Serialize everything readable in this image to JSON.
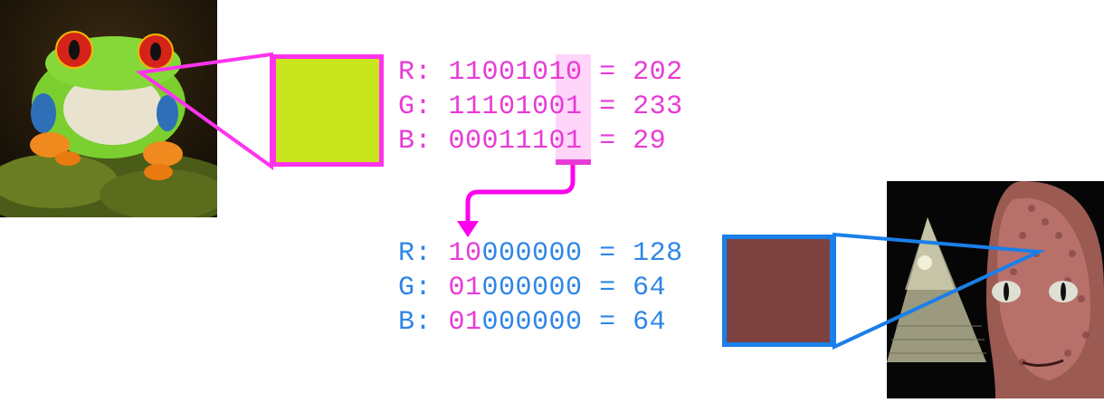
{
  "source": {
    "image": "red-eyed-tree-frog",
    "color_hex": "#c8e61d",
    "rows": [
      {
        "channel": "R: ",
        "bits_high": "110010",
        "bits_low": "10",
        "suffix": " = 202"
      },
      {
        "channel": "G: ",
        "bits_high": "111010",
        "bits_low": "01",
        "suffix": " = 233"
      },
      {
        "channel": "B: ",
        "bits_high": "000111",
        "bits_low": "01",
        "suffix": " = 29"
      }
    ]
  },
  "result": {
    "image": "reptilian-figure-with-pyramid",
    "color_hex": "#7d4240",
    "rows": [
      {
        "channel": "R: ",
        "bits_high": "10",
        "bits_low": "000000",
        "suffix": " = 128"
      },
      {
        "channel": "G: ",
        "bits_high": "01",
        "bits_low": "000000",
        "suffix": " = 64"
      },
      {
        "channel": "B: ",
        "bits_high": "01",
        "bits_low": "000000",
        "suffix": " = 64"
      }
    ]
  },
  "colors": {
    "magenta": "#e83ad6",
    "blue": "#2f86e6",
    "frog_border": "#ff33ee",
    "lizard_border": "#1a7fe8"
  },
  "icons": [
    "arrow-down-icon"
  ]
}
